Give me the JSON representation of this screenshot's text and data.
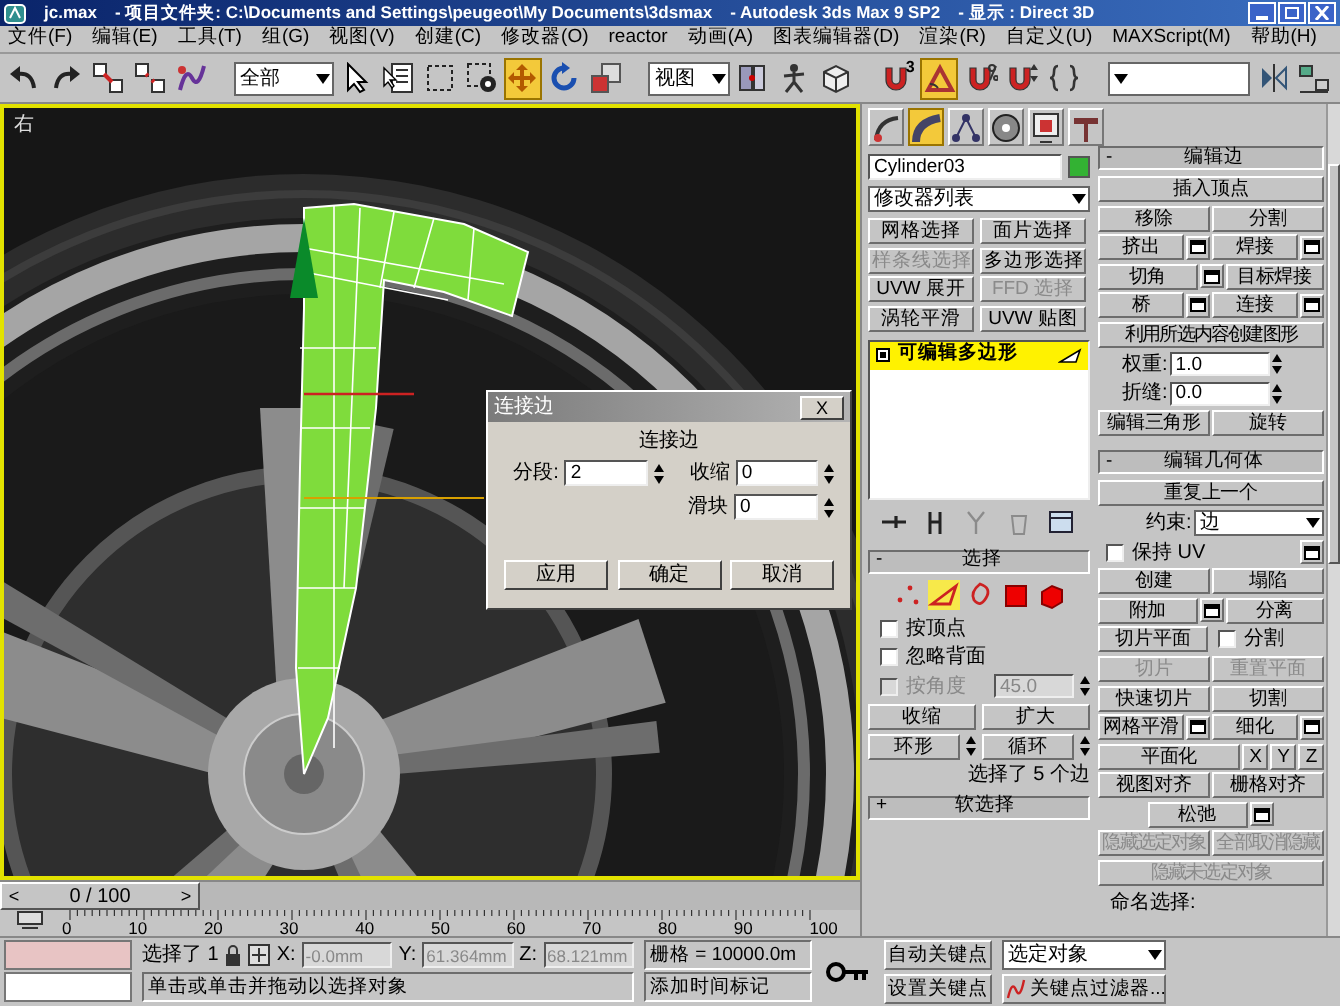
{
  "window": {
    "title_parts": [
      "jc.max",
      "- 项目文件夹: C:\\Documents and Settings\\peugeot\\My Documents\\3dsmax",
      "- Autodesk 3ds Max 9 SP2",
      "- 显示 : Direct 3D"
    ]
  },
  "menu": [
    "文件(F)",
    "编辑(E)",
    "工具(T)",
    "组(G)",
    "视图(V)",
    "创建(C)",
    "修改器(O)",
    "reactor",
    "动画(A)",
    "图表编辑器(D)",
    "渲染(R)",
    "自定义(U)",
    "MAXScript(M)",
    "帮助(H)"
  ],
  "toolbar": [
    {
      "kind": "tool",
      "selected": false
    },
    {
      "kind": "tool",
      "selected": false
    },
    {
      "kind": "tool",
      "selected": false
    },
    {
      "kind": "tool",
      "selected": false
    },
    {
      "kind": "tool",
      "selected": false
    },
    {
      "kind": "dropdown",
      "value": "全部"
    },
    {
      "kind": "tool",
      "selected": false
    },
    {
      "kind": "tool",
      "selected": false
    },
    {
      "kind": "tool",
      "selected": false
    },
    {
      "kind": "tool",
      "selected": false
    },
    {
      "kind": "tool",
      "selected": true
    },
    {
      "kind": "tool",
      "selected": false
    },
    {
      "kind": "tool",
      "selected": false
    },
    {
      "kind": "dropdown",
      "value": "视图"
    },
    {
      "kind": "tool",
      "selected": false
    },
    {
      "kind": "tool",
      "selected": false
    },
    {
      "kind": "tool",
      "selected": false
    },
    {
      "kind": "tool",
      "selected": false,
      "badge": "3"
    },
    {
      "kind": "tool",
      "selected": true
    },
    {
      "kind": "tool",
      "selected": false
    },
    {
      "kind": "tool",
      "selected": false
    },
    {
      "kind": "tool",
      "selected": false
    },
    {
      "kind": "dropdown"
    },
    {
      "kind": "tool",
      "selected": false
    },
    {
      "kind": "tool",
      "selected": false
    }
  ],
  "viewport": {
    "label": "右"
  },
  "dialog": {
    "title": "连接边",
    "close": "X",
    "group": "连接边",
    "fields": [
      {
        "label": "分段:",
        "value": "2"
      },
      {
        "label": "收缩",
        "value": "0"
      },
      {
        "label": "滑块",
        "value": "0"
      }
    ],
    "buttons": [
      "应用",
      "确定",
      "取消"
    ]
  },
  "command_panel": {
    "tabs": [
      {
        "selected": false
      },
      {
        "selected": true
      },
      {
        "selected": false
      },
      {
        "selected": false
      },
      {
        "selected": false
      },
      {
        "selected": false
      }
    ],
    "object_name": "Cylinder03",
    "modifier_list": "修改器列表",
    "modifier_buttons": [
      {
        "label": "网格选择",
        "disabled": false
      },
      {
        "label": "面片选择",
        "disabled": false
      },
      {
        "label": "样条线选择",
        "disabled": true
      },
      {
        "label": "多边形选择",
        "disabled": false
      },
      {
        "label": "UVW 展开",
        "disabled": false
      },
      {
        "label": "FFD 选择",
        "disabled": true
      },
      {
        "label": "涡轮平滑",
        "disabled": false
      },
      {
        "label": "UVW 贴图",
        "disabled": false
      }
    ],
    "stack": [
      {
        "label": "可编辑多边形",
        "selected": true
      }
    ],
    "stack_tools": [
      {
        "disabled": false
      },
      {
        "disabled": false
      },
      {
        "disabled": true
      },
      {
        "disabled": true
      },
      {
        "disabled": false
      }
    ],
    "selection": {
      "title": "选择",
      "collapse_sign": "-",
      "levels": [
        {
          "selected": false
        },
        {
          "selected": true
        },
        {
          "selected": false
        },
        {
          "selected": false
        },
        {
          "selected": false
        }
      ],
      "checks": [
        {
          "label": "按顶点",
          "checked": false,
          "disabled": false
        },
        {
          "label": "忽略背面",
          "checked": false,
          "disabled": false
        },
        {
          "label": "按角度",
          "checked": false,
          "disabled": true,
          "value": "45.0"
        }
      ],
      "buttons": [
        [
          {
            "kind": "button",
            "label": "收缩"
          },
          {
            "kind": "button",
            "label": "扩大"
          }
        ],
        [
          {
            "kind": "spin_button",
            "label": "环形"
          },
          {
            "kind": "spin_button",
            "label": "循环"
          }
        ]
      ],
      "status": "选择了 5 个边"
    },
    "soft_selection": {
      "title": "软选择",
      "collapse_sign": "+"
    },
    "edit_edges": {
      "title": "编辑边",
      "collapse_sign": "-",
      "rows": [
        [
          {
            "kind": "button",
            "label": "插入顶点",
            "disabled": false
          }
        ],
        [
          {
            "kind": "button",
            "label": "移除",
            "disabled": false
          },
          {
            "kind": "button",
            "label": "分割",
            "disabled": false
          }
        ],
        [
          {
            "kind": "button",
            "label": "挤出",
            "disabled": false,
            "settings": true
          },
          {
            "kind": "button",
            "label": "焊接",
            "disabled": false,
            "settings": true
          }
        ],
        [
          {
            "kind": "button",
            "label": "切角",
            "disabled": false,
            "settings": true
          },
          {
            "kind": "button",
            "label": "目标焊接",
            "disabled": false
          }
        ],
        [
          {
            "kind": "button",
            "label": "桥",
            "disabled": false,
            "settings": true
          },
          {
            "kind": "button",
            "label": "连接",
            "disabled": false,
            "settings": true
          }
        ],
        [
          {
            "kind": "button",
            "label": "利用所选内容创建图形",
            "disabled": false
          }
        ],
        [
          {
            "kind": "spinner",
            "label": "权重:",
            "value": "1.0"
          }
        ],
        [
          {
            "kind": "spinner",
            "label": "折缝:",
            "value": "0.0"
          }
        ],
        [
          {
            "kind": "button",
            "label": "编辑三角形",
            "disabled": false
          },
          {
            "kind": "button",
            "label": "旋转",
            "disabled": false
          }
        ]
      ]
    },
    "edit_geometry": {
      "title": "编辑几何体",
      "collapse_sign": "-",
      "rows": [
        [
          {
            "kind": "button",
            "label": "重复上一个",
            "disabled": false
          }
        ],
        [
          {
            "kind": "dropdown",
            "label": "约束:",
            "value": "边"
          }
        ],
        [
          {
            "kind": "checkbox",
            "label": "保持 UV",
            "checked": false,
            "settings": true
          }
        ],
        [
          {
            "kind": "button",
            "label": "创建",
            "disabled": false
          },
          {
            "kind": "button",
            "label": "塌陷",
            "disabled": false
          }
        ],
        [
          {
            "kind": "button",
            "label": "附加",
            "disabled": false,
            "settings": true
          },
          {
            "kind": "button",
            "label": "分离",
            "disabled": false
          }
        ],
        [
          {
            "kind": "button",
            "label": "切片平面",
            "disabled": false
          },
          {
            "kind": "checkbox",
            "label": "分割",
            "checked": false
          }
        ],
        [
          {
            "kind": "button",
            "label": "切片",
            "disabled": true
          },
          {
            "kind": "button",
            "label": "重置平面",
            "disabled": true
          }
        ],
        [
          {
            "kind": "button",
            "label": "快速切片",
            "disabled": false
          },
          {
            "kind": "button",
            "label": "切割",
            "disabled": false
          }
        ],
        [
          {
            "kind": "button",
            "label": "网格平滑",
            "disabled": false,
            "settings": true
          },
          {
            "kind": "button",
            "label": "细化",
            "disabled": false,
            "settings": true
          }
        ],
        [
          {
            "kind": "button",
            "label": "平面化",
            "disabled": false
          },
          {
            "kind": "axis",
            "label": "X"
          },
          {
            "kind": "axis",
            "label": "Y"
          },
          {
            "kind": "axis",
            "label": "Z"
          }
        ],
        [
          {
            "kind": "button",
            "label": "视图对齐",
            "disabled": false
          },
          {
            "kind": "button",
            "label": "栅格对齐",
            "disabled": false
          }
        ],
        [
          {
            "kind": "button",
            "label": "松弛",
            "disabled": false,
            "settings": true
          }
        ],
        [
          {
            "kind": "button",
            "label": "隐藏选定对象",
            "disabled": true
          },
          {
            "kind": "button",
            "label": "全部取消隐藏",
            "disabled": true
          }
        ],
        [
          {
            "kind": "button",
            "label": "隐藏未选定对象",
            "disabled": true
          }
        ],
        [
          {
            "kind": "label",
            "label": "命名选择:"
          }
        ]
      ]
    }
  },
  "time_slider": {
    "position": "0 / 100",
    "prev": "<",
    "next": ">",
    "level": 0
  },
  "ruler": [
    "0",
    "10",
    "20",
    "30",
    "40",
    "50",
    "60",
    "70",
    "80",
    "90",
    "100"
  ],
  "status_bar": {
    "selection": "选择了 1",
    "x_label": "X:",
    "x": "-0.0mm",
    "y_label": "Y:",
    "y": "61.364mm",
    "z_label": "Z:",
    "z": "68.121mm",
    "grid": "栅格 = 10000.0m",
    "prompt": "单击或单击并拖动以选择对象",
    "time_tag": "添加时间标记",
    "auto_key": "自动关键点",
    "key_target": "选定对象",
    "set_key": "设置关键点",
    "key_filters": "关键点过滤器..."
  }
}
